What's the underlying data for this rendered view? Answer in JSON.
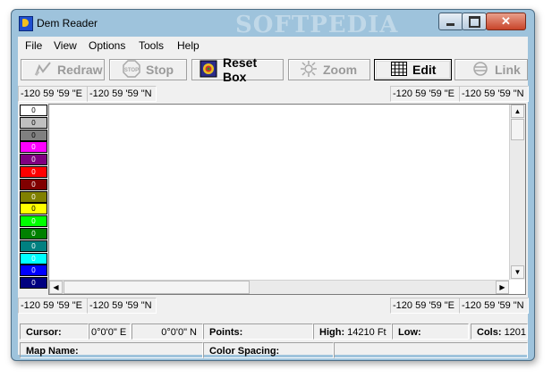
{
  "window": {
    "title": "Dem Reader",
    "watermark": "SOFTPEDIA",
    "close_label": "✕"
  },
  "menu": [
    "File",
    "View",
    "Options",
    "Tools",
    "Help"
  ],
  "toolbar": {
    "redraw": "Redraw",
    "stop": "Stop",
    "reset_box": "Reset Box",
    "zoom": "Zoom",
    "edit": "Edit",
    "link": "Link"
  },
  "coords_top": {
    "left_e": "-120 59 '59 \"E",
    "left_n": "-120 59 '59 \"N",
    "right_e": "-120 59 '59 \"E",
    "right_n": "-120 59 '59 \"N"
  },
  "coords_bottom": {
    "left_e": "-120 59 '59 \"E",
    "left_n": "-120 59 '59 \"N",
    "right_e": "-120 59 '59 \"E",
    "right_n": "-120 59 '59 \"N"
  },
  "legend": [
    {
      "label": "0",
      "color": "#ffffff",
      "text": "#000000"
    },
    {
      "label": "0",
      "color": "#c0c0c0",
      "text": "#000000"
    },
    {
      "label": "0",
      "color": "#808080",
      "text": "#000000"
    },
    {
      "label": "0",
      "color": "#ff00ff",
      "text": "#ffffff"
    },
    {
      "label": "0",
      "color": "#800080",
      "text": "#ffffff"
    },
    {
      "label": "0",
      "color": "#ff0000",
      "text": "#ffffff"
    },
    {
      "label": "0",
      "color": "#800000",
      "text": "#ffffff"
    },
    {
      "label": "0",
      "color": "#808000",
      "text": "#ffffff"
    },
    {
      "label": "0",
      "color": "#ffff00",
      "text": "#000000"
    },
    {
      "label": "0",
      "color": "#00ff00",
      "text": "#ffffff"
    },
    {
      "label": "0",
      "color": "#008000",
      "text": "#ffffff"
    },
    {
      "label": "0",
      "color": "#008080",
      "text": "#ffffff"
    },
    {
      "label": "0",
      "color": "#00ffff",
      "text": "#ffffff"
    },
    {
      "label": "0",
      "color": "#0000ff",
      "text": "#ffffff"
    },
    {
      "label": "0",
      "color": "#000080",
      "text": "#ffffff"
    }
  ],
  "status": {
    "cursor_label": "Cursor:",
    "cursor_lon": "0°0'0\" E",
    "cursor_lat": "0°0'0\" N",
    "points_label": "Points:",
    "high_label": "High:",
    "high_value": "14210 Ft",
    "low_label": "Low:",
    "cols_label": "Cols:",
    "cols_value": "1201",
    "map_name_label": "Map Name:",
    "color_spacing_label": "Color Spacing:"
  }
}
